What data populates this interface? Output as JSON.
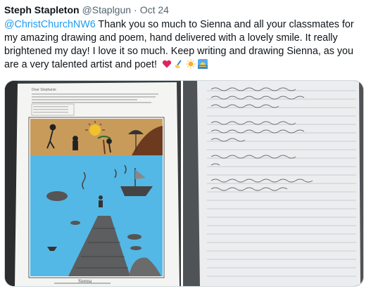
{
  "tweet": {
    "author_name": "Steph Stapleton",
    "author_handle": "@Staplgun",
    "separator": "·",
    "date": "Oct 24",
    "mention": "@ChristChurchNW6",
    "text": " Thank you so much to Sienna and all your classmates for my amazing drawing and poem, hand delivered with a lovely smile. It really brightened my day! I love it so much. Keep writing and drawing Sienna, as you are a very talented artist and poet!",
    "emojis": [
      "red-heart",
      "writing-hand",
      "sun",
      "sunrise"
    ]
  },
  "photos": {
    "left": {
      "letter_heading": "Dear Stephanie",
      "signature": "Sienna"
    },
    "right": {
      "description_hidden": false
    }
  },
  "colors": {
    "link": "#1d9bf0",
    "muted": "#536471",
    "text": "#0f1419",
    "sea": "#4fb7e6",
    "sand": "#c79a55"
  }
}
